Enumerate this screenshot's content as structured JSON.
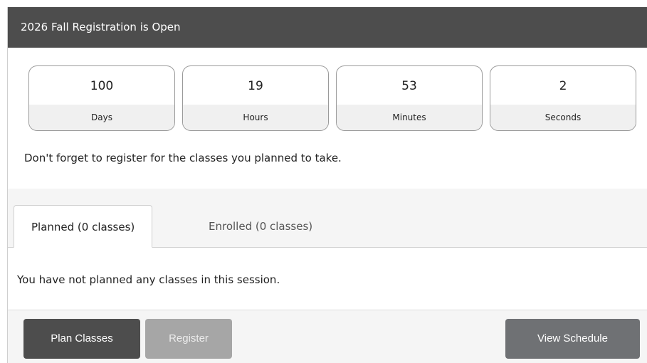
{
  "header": {
    "title": "2026 Fall Registration is Open"
  },
  "countdown": [
    {
      "value": "100",
      "unit": "Days"
    },
    {
      "value": "19",
      "unit": "Hours"
    },
    {
      "value": "53",
      "unit": "Minutes"
    },
    {
      "value": "2",
      "unit": "Seconds"
    }
  ],
  "reminder": "Don't forget to register for the classes you planned to take.",
  "tabs": [
    {
      "label": "Planned (0 classes)",
      "active": true
    },
    {
      "label": "Enrolled (0 classes)",
      "active": false
    }
  ],
  "empty_message": "You have not planned any classes in this session.",
  "footer": {
    "plan_label": "Plan Classes",
    "register_label": "Register",
    "view_schedule_label": "View Schedule"
  },
  "colors": {
    "header_bg": "#4d4d4d",
    "primary_button": "#4d4d4d",
    "disabled_button": "#a6a6a6",
    "secondary_button": "#6f7174"
  }
}
